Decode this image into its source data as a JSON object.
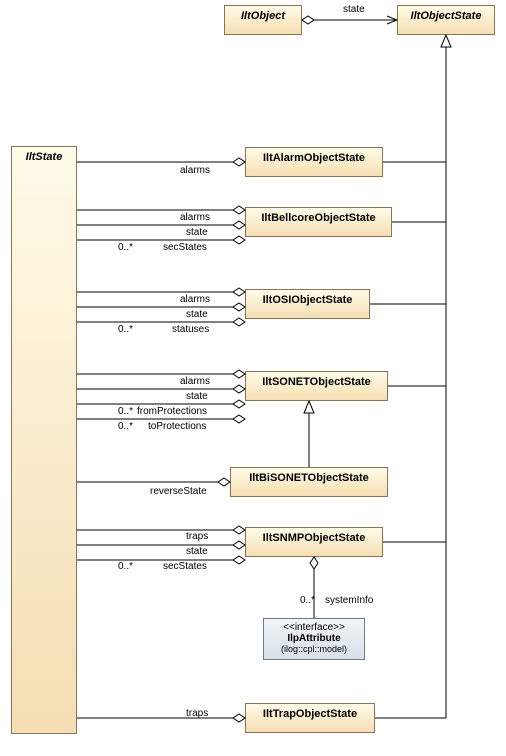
{
  "classes": {
    "IltObject": "IltObject",
    "IltObjectState": "IltObjectState",
    "IltState": "IltState",
    "IltAlarmObjectState": "IltAlarmObjectState",
    "IltBellcoreObjectState": "IltBellcoreObjectState",
    "IltOSIObjectState": "IltOSIObjectState",
    "IltSONETObjectState": "IltSONETObjectState",
    "IltBiSONETObjectState": "IltBiSONETObjectState",
    "IltSNMPObjectState": "IltSNMPObjectState",
    "IltTrapObjectState": "IltTrapObjectState"
  },
  "interface": {
    "stereotype": "<<interface>>",
    "name": "IlpAttribute",
    "package": "(ilog::cpl::model)"
  },
  "labels": {
    "state_top": "state",
    "alarm_alarms": "alarms",
    "bellcore_alarms": "alarms",
    "bellcore_state": "state",
    "bellcore_sec": "secStates",
    "bellcore_mult": "0..*",
    "osi_alarms": "alarms",
    "osi_state": "state",
    "osi_statuses": "statuses",
    "osi_mult": "0..*",
    "sonet_alarms": "alarms",
    "sonet_state": "state",
    "sonet_from": "fromProtections",
    "sonet_to": "toProtections",
    "sonet_mult1": "0..*",
    "sonet_mult2": "0..*",
    "bisonet_reverse": "reverseState",
    "snmp_traps": "traps",
    "snmp_state": "state",
    "snmp_sec": "secStates",
    "snmp_mult": "0..*",
    "snmp_sysinfo": "systemInfo",
    "snmp_sysmult": "0..*",
    "trap_traps": "traps"
  }
}
